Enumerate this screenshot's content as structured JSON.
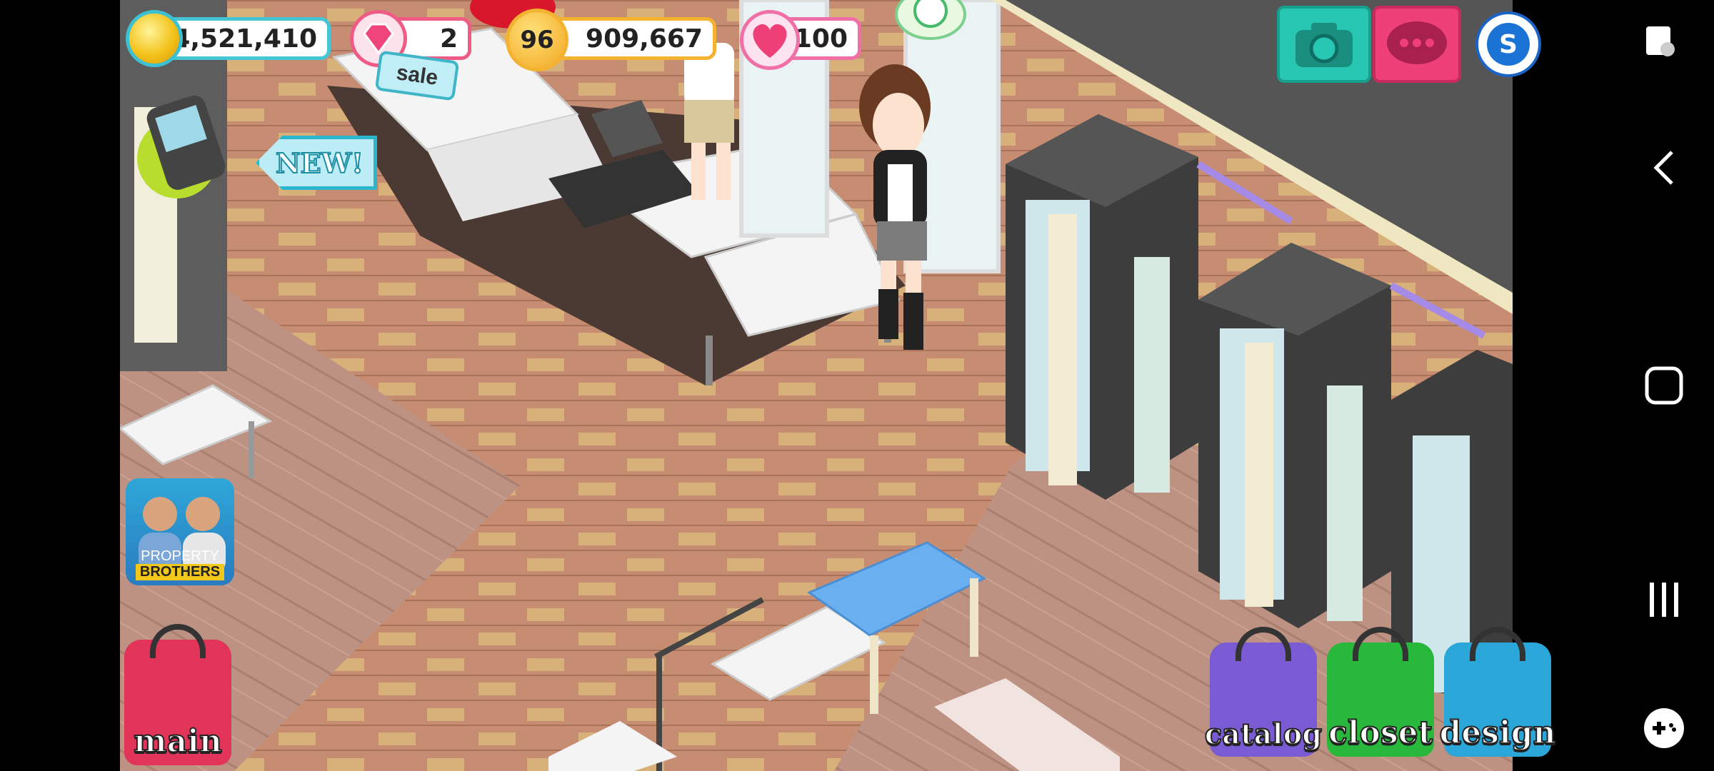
{
  "hud": {
    "coins": "14,521,410",
    "gems": "2",
    "gems_sale": "sale",
    "level": "96",
    "xp": "909,667",
    "hearts": "100"
  },
  "left_panel": {
    "new_badge": "NEW!",
    "ad_line1": "PROPERTY",
    "ad_line2": "BROTHERS"
  },
  "bottom_buttons": {
    "main": "main",
    "catalog": "catalog",
    "closet": "closet",
    "design": "design"
  },
  "icons": {
    "coin": "coin-icon",
    "gem": "gem-icon",
    "star": "star-icon",
    "heart": "heart-icon",
    "camera": "camera-icon",
    "chat": "chat-icon",
    "currency": "currency-s-icon",
    "phone": "phone-icon"
  },
  "colors": {
    "hud_border": "#45c6d6",
    "gem_border": "#f05b86",
    "level_border": "#f3b230",
    "heart_border": "#f16fa7",
    "catalog": "#7b5bd3",
    "closet": "#28b83b",
    "design": "#2aa7d8",
    "main": "#e23359"
  }
}
